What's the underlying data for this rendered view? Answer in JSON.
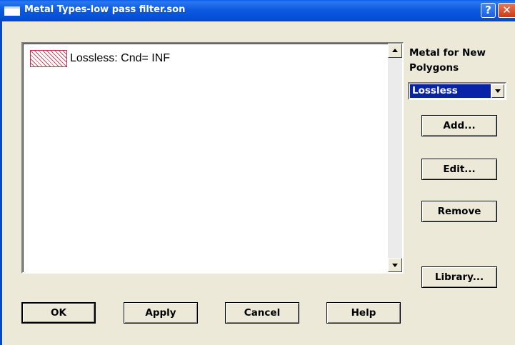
{
  "window": {
    "title": "Metal Types-low pass filter.son",
    "help_glyph": "?",
    "close_glyph": "✕"
  },
  "metals": {
    "items": [
      {
        "label": "Lossless:  Cnd= INF",
        "swatch_color": "#d24a64"
      }
    ]
  },
  "side_panel": {
    "label": "Metal for New Polygons",
    "selected_metal": "Lossless",
    "add_label": "Add...",
    "edit_label": "Edit...",
    "remove_label": "Remove",
    "library_label": "Library..."
  },
  "footer": {
    "ok_label": "OK",
    "apply_label": "Apply",
    "cancel_label": "Cancel",
    "help_label": "Help"
  },
  "colors": {
    "titlebar": "#0350d6",
    "dialog_bg": "#ece9d8",
    "selection": "#0a24a8"
  },
  "icons": [
    "app-window-icon",
    "help-icon",
    "close-icon",
    "scroll-up-arrow-icon",
    "scroll-down-arrow-icon",
    "chevron-down-icon"
  ]
}
